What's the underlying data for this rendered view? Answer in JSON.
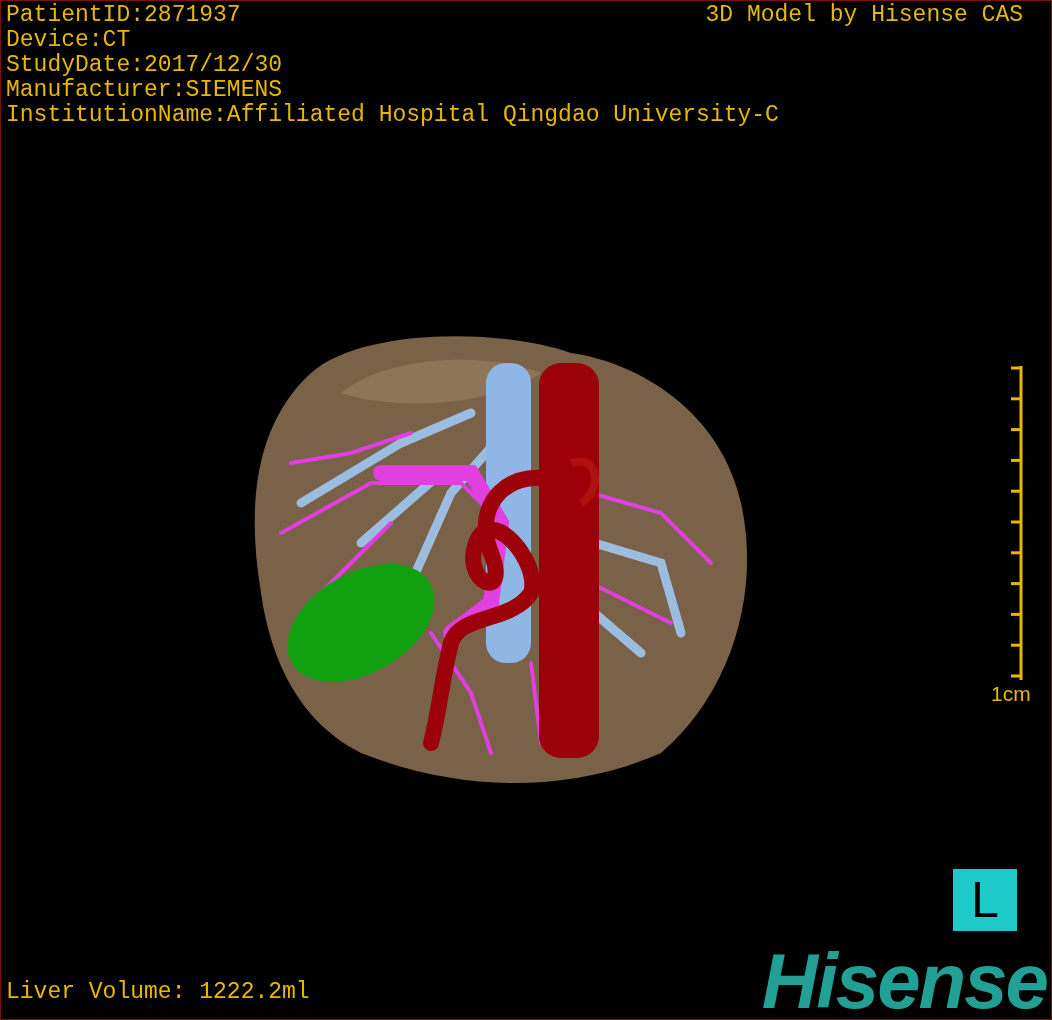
{
  "info_lines": [
    "PatientID:2871937",
    "Device:CT",
    "StudyDate:2017/12/30",
    "Manufacturer:SIEMENS",
    "InstitutionName:Affiliated Hospital Qingdao University-C"
  ],
  "title": "3D Model by Hisense CAS",
  "scale": {
    "label": "1cm"
  },
  "orientation_marker": "L",
  "liver_volume": "Liver Volume: 1222.2ml",
  "logo": "Hisense"
}
